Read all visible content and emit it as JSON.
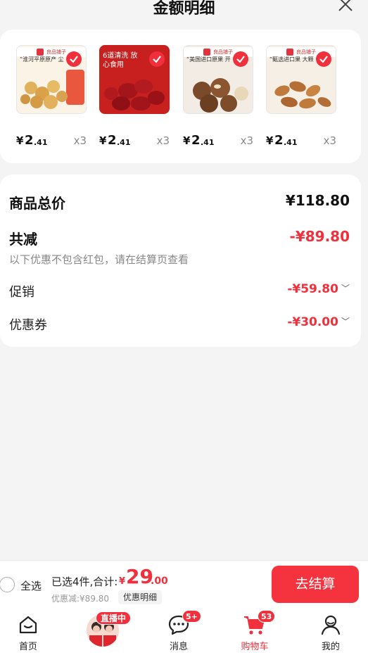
{
  "header": {
    "title": "金额明细",
    "close_icon": "close-icon"
  },
  "products": [
    {
      "tagline": "“淮河平原原产 尘",
      "price_yen": "¥",
      "price_int": "2",
      "price_dec": ".41",
      "qty": "x3"
    },
    {
      "tagline": "6道清洗 放心食用",
      "price_yen": "¥",
      "price_int": "2",
      "price_dec": ".41",
      "qty": "x3"
    },
    {
      "tagline": "“美国进口原果 开",
      "price_yen": "¥",
      "price_int": "2",
      "price_dec": ".41",
      "qty": "x3"
    },
    {
      "tagline": "“甄选进口果 大颗",
      "price_yen": "¥",
      "price_int": "2",
      "price_dec": ".41",
      "qty": "x3"
    }
  ],
  "brand_badge": "良品铺子",
  "summary": {
    "total_label": "商品总价",
    "total_value": "¥118.80",
    "reduce_label": "共减",
    "reduce_value": "-¥89.80",
    "note": "以下优惠不包含红包，请在结算页查看",
    "promo_label": "促销",
    "promo_value": "-¥59.80",
    "coupon_label": "优惠券",
    "coupon_value": "-¥30.00"
  },
  "bottom_bar": {
    "select_all": "全选",
    "selected_summary": "已选4件,合计:",
    "total_yen": "¥",
    "total_int": "29",
    "total_dec": ".00",
    "discount": "优惠减:¥89.80",
    "detail_link": "优惠明细",
    "checkout": "去结算"
  },
  "tabbar": {
    "home": "首页",
    "live_badge": "直播中",
    "messages": "消息",
    "messages_badge": "5+",
    "cart": "购物车",
    "cart_badge": "53",
    "me": "我的"
  },
  "colors": {
    "accent": "#f0303c",
    "background": "#f4f4f4"
  }
}
